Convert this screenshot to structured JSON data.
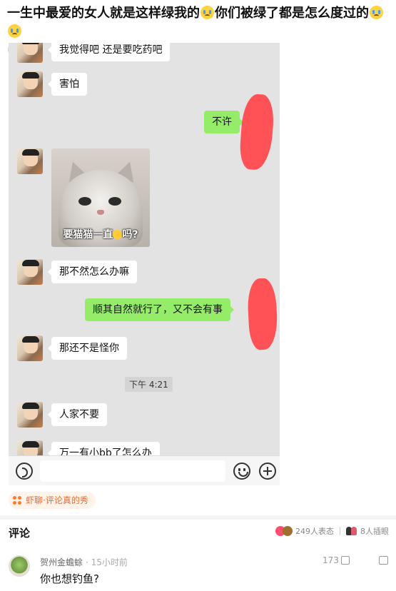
{
  "post": {
    "title": "一生中最爱的女人就是这样绿我的",
    "title_mid": "你们被绿了都是怎么度过的",
    "title_emoji": "crying-face-emoji"
  },
  "chat": {
    "messages": [
      {
        "side": "left",
        "text": "我觉得吧 还是要吃药吧"
      },
      {
        "side": "left",
        "text": "害怕"
      },
      {
        "side": "right",
        "text": "不许"
      },
      {
        "side": "left",
        "type": "sticker",
        "caption_a": "要猫猫一直",
        "caption_b": "吗?"
      },
      {
        "side": "left",
        "text": "那不然怎么办嘛"
      },
      {
        "side": "right",
        "text": "顺其自然就行了，又不会有事"
      },
      {
        "side": "left",
        "text": "那还不是怪你"
      },
      {
        "side": "left",
        "text": "人家不要"
      },
      {
        "side": "left",
        "text": "万一有小bb了怎么办"
      }
    ],
    "timestamp": "下午 4:21",
    "scribble_color": "#ff5257",
    "bubble_colors": {
      "left": "#ffffff",
      "right": "#95ec69"
    }
  },
  "topic_tag": {
    "label": "虾聊·评论真的秀",
    "color": "#f06a2a"
  },
  "comments_section": {
    "header": "评论",
    "reaction_count": "249人表态",
    "stickers_count": "8人插眼"
  },
  "comment": {
    "user": "贺州金蟾蜍",
    "time": "· 15小时前",
    "text": "你也想钓鱼?",
    "likes": "173"
  }
}
